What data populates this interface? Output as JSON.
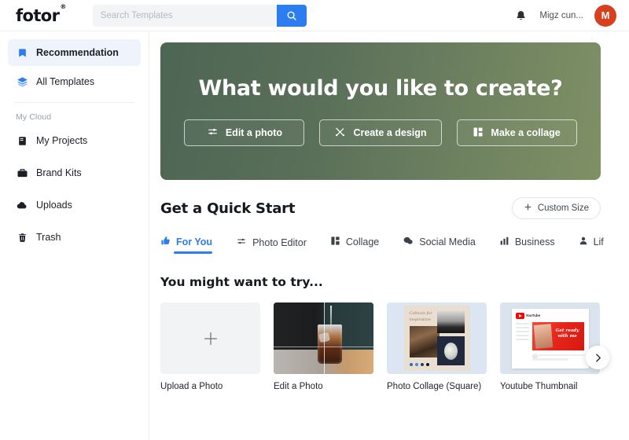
{
  "brand": {
    "name": "fotor",
    "trademark": "®",
    "accent": "#2b7df0"
  },
  "search": {
    "placeholder": "Search Templates",
    "value": "",
    "icon": "search-icon"
  },
  "account": {
    "notifications_icon": "bell-icon",
    "username": "Migz cun...",
    "avatar_initial": "M",
    "avatar_color": "#d6401e"
  },
  "sidebar": {
    "primary": [
      {
        "label": "Recommendation",
        "icon": "bookmark-icon",
        "active": true
      },
      {
        "label": "All Templates",
        "icon": "layers-icon",
        "active": false
      }
    ],
    "group_title": "My Cloud",
    "cloud": [
      {
        "label": "My Projects",
        "icon": "document-icon"
      },
      {
        "label": "Brand Kits",
        "icon": "briefcase-icon"
      },
      {
        "label": "Uploads",
        "icon": "cloud-upload-icon"
      },
      {
        "label": "Trash",
        "icon": "trash-icon"
      }
    ]
  },
  "hero": {
    "title": "What would you like to create?",
    "gradient_from": "#4d6554",
    "gradient_to": "#7f9064",
    "buttons": [
      {
        "label": "Edit a photo",
        "icon": "sliders-icon"
      },
      {
        "label": "Create a design",
        "icon": "design-tools-icon"
      },
      {
        "label": "Make a collage",
        "icon": "collage-grid-icon"
      }
    ]
  },
  "quick_start": {
    "title": "Get a Quick Start",
    "custom_size": {
      "label": "Custom Size",
      "icon": "plus-icon"
    },
    "tabs": [
      {
        "label": "For You",
        "icon": "thumbs-up-icon",
        "active": true
      },
      {
        "label": "Photo Editor",
        "icon": "sliders-icon",
        "active": false
      },
      {
        "label": "Collage",
        "icon": "collage-grid-icon",
        "active": false
      },
      {
        "label": "Social Media",
        "icon": "chat-icon",
        "active": false
      },
      {
        "label": "Business",
        "icon": "bar-chart-icon",
        "active": false
      },
      {
        "label": "Lif",
        "icon": "person-icon",
        "active": false
      }
    ]
  },
  "suggestions": {
    "title": "You might want to try...",
    "cards": [
      {
        "label": "Upload a Photo",
        "thumb": "upload-placeholder"
      },
      {
        "label": "Edit a Photo",
        "thumb": "cola-glass-photo"
      },
      {
        "label": "Photo Collage (Square)",
        "thumb": "collage-preview"
      },
      {
        "label": "Youtube Thumbnail",
        "thumb": "youtube-preview"
      }
    ],
    "collage_script": "Collects for inspiration",
    "collage_dots": [
      "#2b6cc4",
      "#3f8fd8",
      "#1f3f73",
      "#111827"
    ],
    "youtube_brand": "YouTube",
    "youtube_script": "Get ready with me",
    "next_icon": "chevron-right-icon"
  }
}
